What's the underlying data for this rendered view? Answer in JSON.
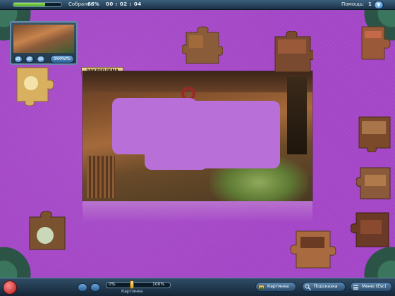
{
  "top_bar": {
    "assembled_label": "Собрано:",
    "assembled_value": "66%",
    "assembled_progress": 0.66,
    "timer": "00 : 02 : 04",
    "hints_label": "Помощь:",
    "hints_value": "1",
    "hint_icon": "down-arrow-icon"
  },
  "preview": {
    "zoom_buttons": [
      "x1",
      "x2",
      "x3"
    ],
    "close_label": "ЗАКРЫТЬ"
  },
  "board": {
    "pinned_tag": "ЗАКРЕПЛЕНА"
  },
  "bottom_bar": {
    "slider_min": "0%",
    "slider_max": "100%",
    "slider_value": 0.4,
    "slider_caption": "Картинка",
    "buttons": [
      {
        "label": "Картинка",
        "icon": "picture-icon"
      },
      {
        "label": "Подсказка",
        "icon": "magnifier-icon"
      },
      {
        "label": "Меню (Esc)",
        "icon": "menu-icon"
      }
    ]
  },
  "colors": {
    "felt": "#a647c9",
    "bar": "#1b3247",
    "progress": "#6cc23a"
  }
}
